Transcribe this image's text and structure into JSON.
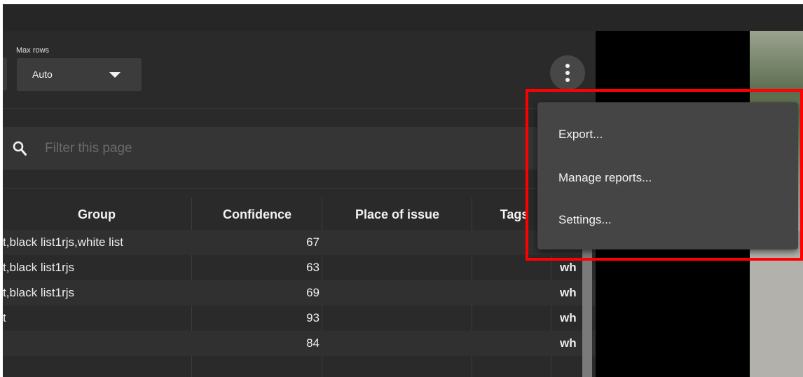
{
  "toolbar": {
    "max_rows_label": "Max rows",
    "max_rows_value": "Auto"
  },
  "filter": {
    "placeholder": "Filter this page"
  },
  "table": {
    "columns": [
      "Group",
      "Confidence",
      "Place of issue",
      "Tags"
    ],
    "rows": [
      {
        "group": "t,black list1rjs,white list",
        "confidence": "67",
        "tags": ""
      },
      {
        "group": "t,black list1rjs",
        "confidence": "63",
        "tags": "wh"
      },
      {
        "group": "t,black list1rjs",
        "confidence": "69",
        "tags": "wh"
      },
      {
        "group": "t",
        "confidence": "93",
        "tags": "wh"
      },
      {
        "group": "",
        "confidence": "84",
        "tags": "wh"
      }
    ]
  },
  "menu": {
    "items": [
      "Export...",
      "Manage reports...",
      "Settings..."
    ]
  },
  "colors": {
    "background": "#2a2a2a",
    "menu": "#454545",
    "highlight": "#ff0000"
  }
}
